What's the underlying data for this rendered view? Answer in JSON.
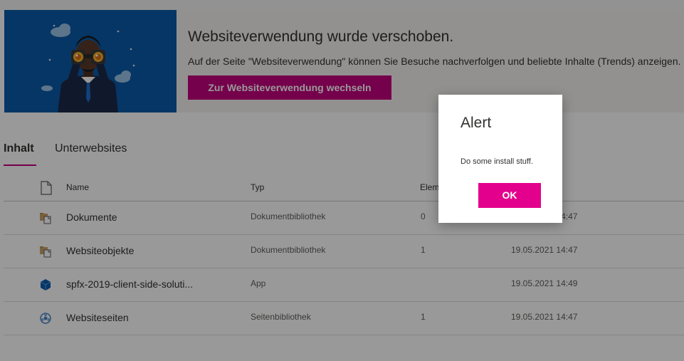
{
  "banner": {
    "title": "Websiteverwendung wurde verschoben.",
    "description": "Auf der Seite \"Websiteverwendung\" können Sie Besuche nachverfolgen und beliebte Inhalte (Trends) anzeigen.",
    "button_label": "Zur Websiteverwendung wechseln",
    "image_bg": "#0a5aa8",
    "button_color": "#c3007e"
  },
  "tabs": [
    {
      "label": "Inhalt",
      "active": true
    },
    {
      "label": "Unterwebsites",
      "active": false
    }
  ],
  "table": {
    "header_icon": "document-icon",
    "columns": [
      "Name",
      "Typ",
      "Elem",
      ""
    ],
    "rows": [
      {
        "icon": "library-folder-icon",
        "name": "Dokumente",
        "type": "Dokumentbibliothek",
        "count": "0",
        "date": "19.05.2021 14:47"
      },
      {
        "icon": "library-folder-icon",
        "name": "Websiteobjekte",
        "type": "Dokumentbibliothek",
        "count": "1",
        "date": "19.05.2021 14:47"
      },
      {
        "icon": "app-icon",
        "name": "spfx-2019-client-side-soluti...",
        "type": "App",
        "count": "",
        "date": "19.05.2021 14:49"
      },
      {
        "icon": "site-pages-icon",
        "name": "Websiteseiten",
        "type": "Seitenbibliothek",
        "count": "1",
        "date": "19.05.2021 14:47"
      }
    ]
  },
  "dialog": {
    "title": "Alert",
    "message": "Do some install stuff.",
    "ok_label": "OK",
    "ok_color": "#e3008c"
  }
}
